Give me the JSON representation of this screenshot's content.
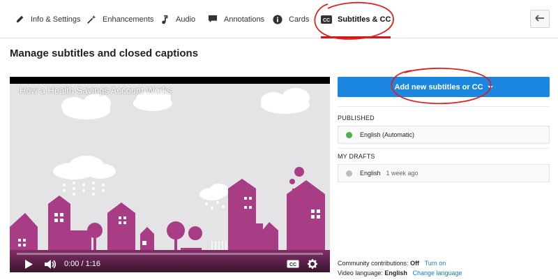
{
  "tabs": [
    {
      "label": "Info & Settings",
      "icon": "pencil-icon"
    },
    {
      "label": "Enhancements",
      "icon": "magic-wand-icon"
    },
    {
      "label": "Audio",
      "icon": "music-note-icon"
    },
    {
      "label": "Annotations",
      "icon": "speech-bubble-icon"
    },
    {
      "label": "Cards",
      "icon": "info-icon"
    },
    {
      "label": "Subtitles & CC",
      "icon": "cc-icon",
      "active": true
    }
  ],
  "back_button": {
    "icon": "back-arrow-icon"
  },
  "page": {
    "title": "Manage subtitles and closed captions"
  },
  "video": {
    "title": "How a Health Savings Account Works",
    "time": "0:00 / 1:16",
    "progress": 0.0,
    "scene_colors": {
      "sky": "#e4e4e6",
      "buildings": "#a83c85",
      "ground": "#7d2e64",
      "clouds": "#ffffff"
    }
  },
  "panel": {
    "add_button": "Add new subtitles or CC",
    "published_header": "PUBLISHED",
    "published_items": [
      {
        "language": "English (Automatic)",
        "status_color": "#4caf50"
      }
    ],
    "drafts_header": "MY DRAFTS",
    "draft_items": [
      {
        "language": "English",
        "meta": "1 week ago",
        "status_color": "#bdbdbd"
      }
    ],
    "community": {
      "label": "Community contributions:",
      "value": "Off",
      "link": "Turn on"
    },
    "language": {
      "label": "Video language:",
      "value": "English",
      "link": "Change language"
    }
  },
  "colors": {
    "accent_red": "#cc181e",
    "button_blue": "#1c87e0",
    "link_blue": "#167ac6",
    "annotation_red": "#e0201b"
  }
}
